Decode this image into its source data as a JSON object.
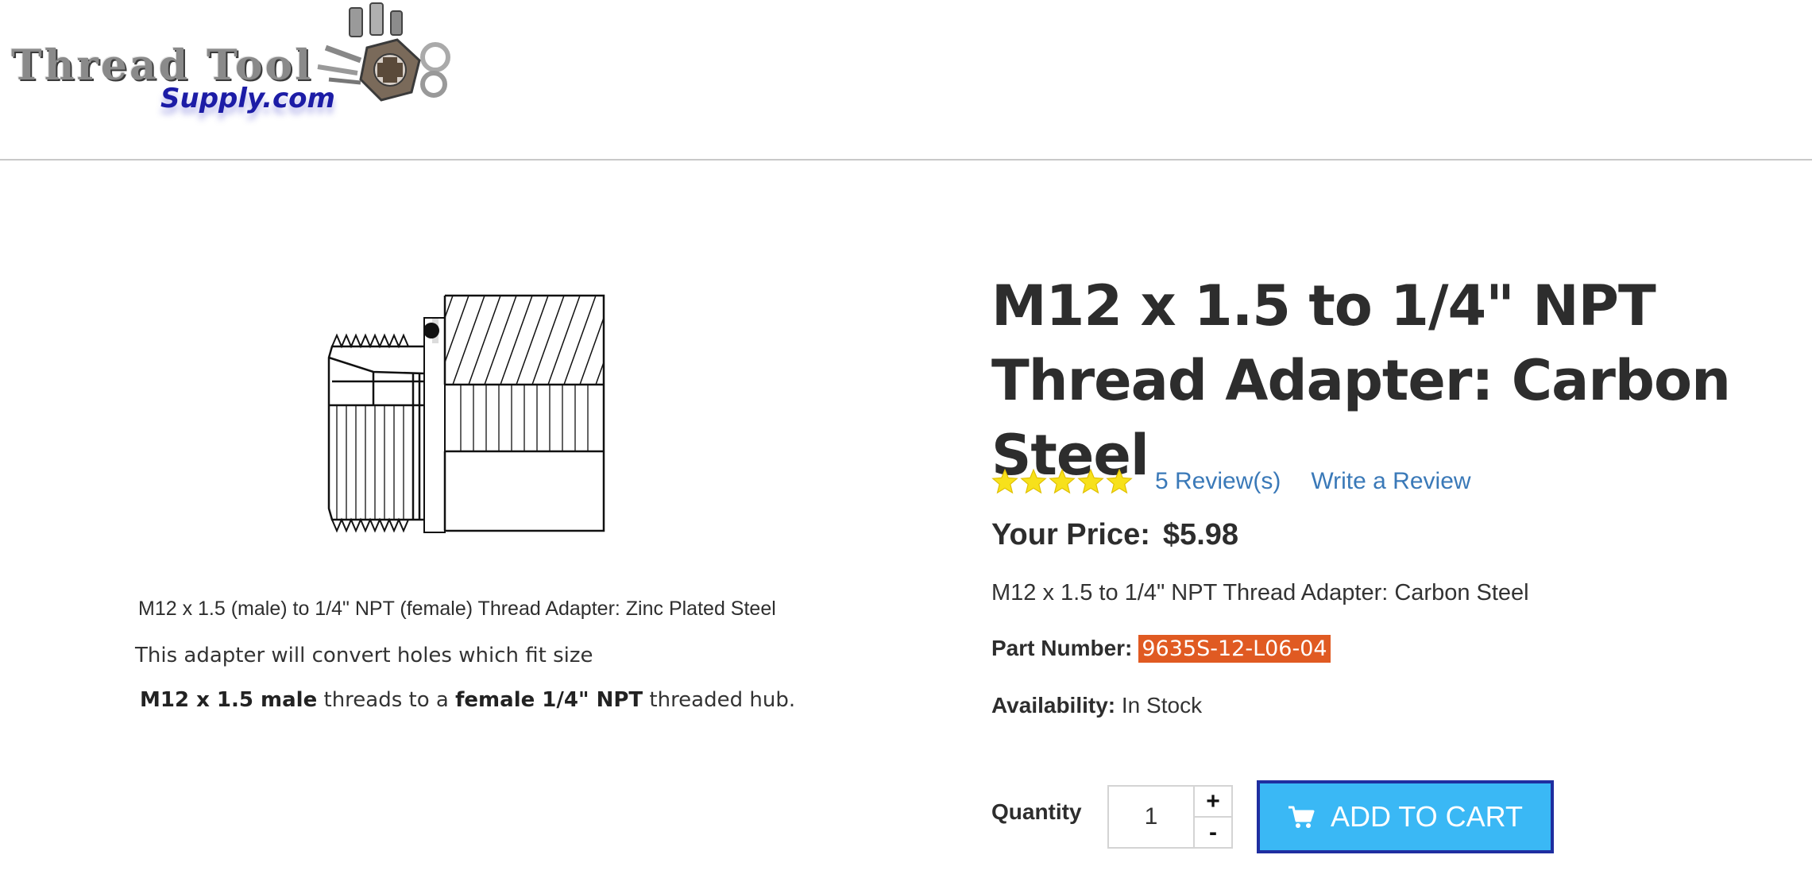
{
  "header": {
    "logo_line_1": "Thread Tool",
    "logo_line_2": "Supply.com"
  },
  "product": {
    "title": "M12 x 1.5 to 1/4\" NPT Thread Adapter: Carbon Steel",
    "rating": {
      "stars": 5,
      "max_stars": 5,
      "reviews_link": "5 Review(s)",
      "write_review_link": "Write a Review"
    },
    "price_label": "Your Price:",
    "price_value": "$5.98",
    "subtitle": "M12 x 1.5 to 1/4\" NPT Thread Adapter: Carbon Steel",
    "part_number_label": "Part Number:",
    "part_number_value": "9635S-12-L06-04",
    "availability_label": "Availability:",
    "availability_value": "In Stock",
    "image_caption": "M12 x 1.5 (male) to 1/4\" NPT (female) Thread Adapter: Zinc Plated Steel",
    "description": {
      "line_1": "This adapter will convert holes which fit size",
      "line_2_bold_1": "M12 x 1.5 male",
      "line_2_text_1": " threads to a ",
      "line_2_bold_2": "female 1/4\" NPT",
      "line_2_text_2": " threaded hub."
    }
  },
  "purchase": {
    "quantity_label": "Quantity",
    "quantity_value": "1",
    "increment": "+",
    "decrement": "-",
    "add_to_cart": "ADD TO CART"
  },
  "colors": {
    "link": "#3a79b8",
    "star": "#f7e11b",
    "part_highlight": "#e05a22",
    "button": "#3ab8f5",
    "button_border": "#1f2ea0"
  },
  "icons": [
    "star-icon",
    "cart-icon"
  ]
}
